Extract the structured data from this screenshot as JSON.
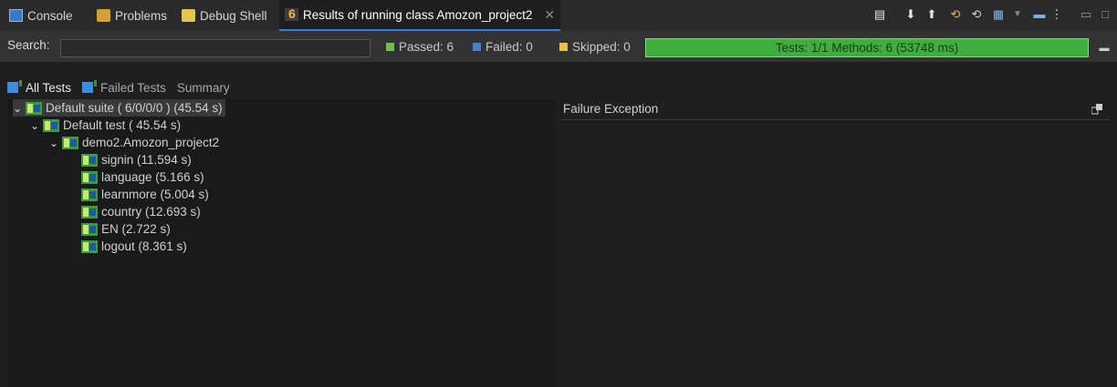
{
  "tabs": [
    {
      "label": "Console",
      "icon": "console-icon"
    },
    {
      "label": "Problems",
      "icon": "problems-icon"
    },
    {
      "label": "Debug Shell",
      "icon": "debug-shell-icon"
    },
    {
      "label": "Results of running class Amozon_project2",
      "icon": "testng-icon",
      "active": true
    }
  ],
  "toolbar": {
    "icons": [
      "export-report-icon",
      "next-failure-icon",
      "previous-failure-icon",
      "rerun-icon",
      "rerun-failed-icon",
      "layout-icon",
      "dropdown-icon",
      "view-menu-icon",
      "more-icon",
      "minimize-icon",
      "maximize-icon"
    ]
  },
  "search": {
    "label": "Search:",
    "value": ""
  },
  "stats": {
    "passed": "Passed: 6",
    "failed": "Failed: 0",
    "skipped": "Skipped: 0"
  },
  "progress": {
    "text": "Tests: 1/1  Methods: 6 (53748 ms)",
    "fraction": 1.0,
    "color": "#3fae3f"
  },
  "subtabs": {
    "all": "All Tests",
    "failed": "Failed Tests",
    "summary": "Summary"
  },
  "tree": {
    "suite": "Default suite ( 6/0/0/0 ) (45.54 s)",
    "test": "Default test ( 45.54 s)",
    "class": "demo2.Amozon_project2",
    "methods": [
      "signin  (11.594 s)",
      "language  (5.166 s)",
      "learnmore  (5.004 s)",
      "country  (12.693 s)",
      "EN  (2.722 s)",
      "logout  (8.361 s)"
    ]
  },
  "failure": {
    "title": "Failure Exception"
  },
  "colors": {
    "passed": "#6ac44a",
    "failed": "#4a7fd8",
    "skipped": "#e8c53a",
    "accent": "#3f7ccf"
  }
}
